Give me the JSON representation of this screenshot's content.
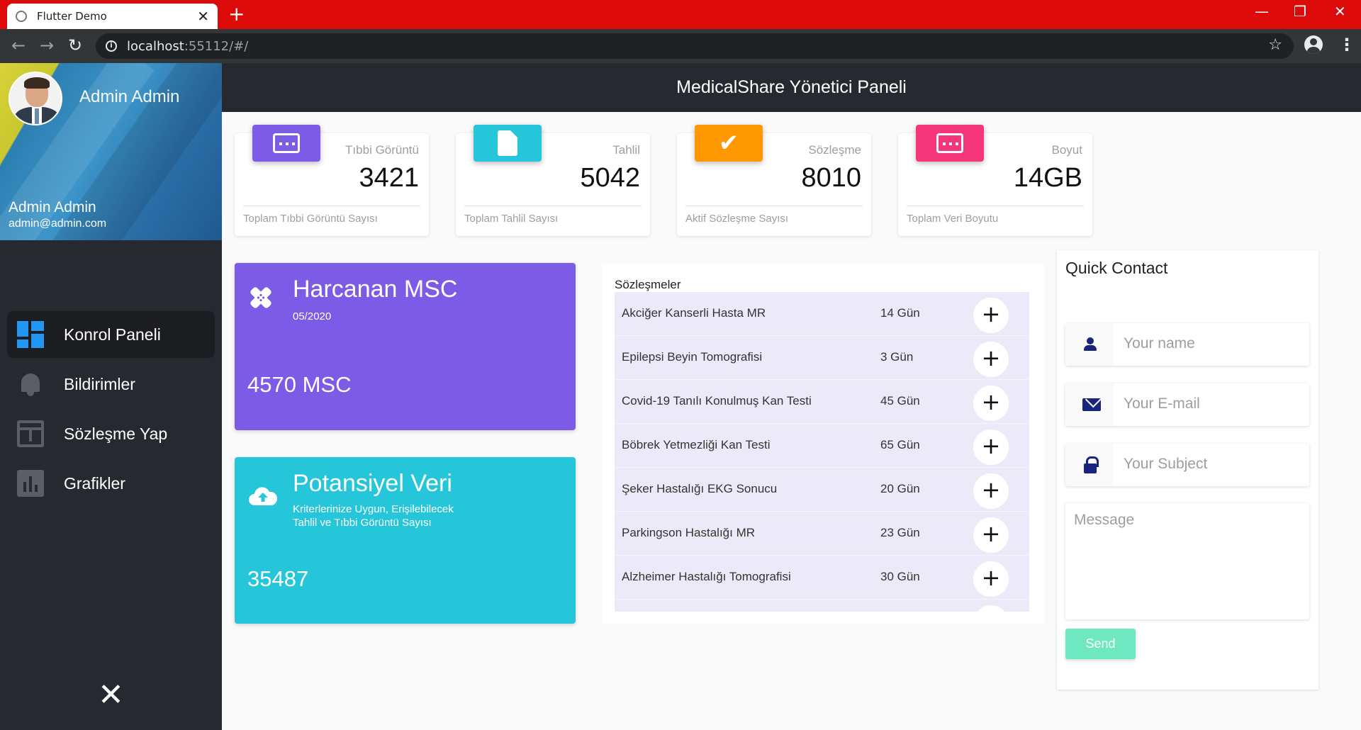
{
  "browser": {
    "tab_title": "Flutter Demo",
    "url_host": "localhost",
    "url_rest": ":55112/#/"
  },
  "sidebar": {
    "header_name": "Admin Admin",
    "user_name": "Admin Admin",
    "user_email": "admin@admin.com",
    "items": [
      {
        "label": "Konrol Paneli",
        "icon": "dashboard-icon",
        "active": true
      },
      {
        "label": "Bildirimler",
        "icon": "bell-icon",
        "active": false
      },
      {
        "label": "Sözleşme Yap",
        "icon": "contract-icon",
        "active": false
      },
      {
        "label": "Grafikler",
        "icon": "bar-chart-icon",
        "active": false
      }
    ]
  },
  "appbar": {
    "title": "MedicalShare Yönetici Paneli"
  },
  "stats": [
    {
      "label": "Tıbbi Görüntü",
      "value": "3421",
      "footer": "Toplam Tıbbi Görüntü Sayısı",
      "color": "#7c5ce6",
      "icon": "web-window-icon"
    },
    {
      "label": "Tahlil",
      "value": "5042",
      "footer": "Toplam Tahlil Sayısı",
      "color": "#26c6da",
      "icon": "document-icon"
    },
    {
      "label": "Sözleşme",
      "value": "8010",
      "footer": "Aktif Sözleşme Sayısı",
      "color": "#ff9800",
      "icon": "check-icon"
    },
    {
      "label": "Boyut",
      "value": "14GB",
      "footer": "Toplam Veri Boyutu",
      "color": "#f5367a",
      "icon": "web-window-icon"
    }
  ],
  "msc_card": {
    "title": "Harcanan MSC",
    "subtitle": "05/2020",
    "value": "4570 MSC",
    "color": "#7c5ce6",
    "icon": "bandage-icon"
  },
  "data_card": {
    "title": "Potansiyel Veri",
    "subtitle_line1": "Kriterlerinize Uygun, Erişilebilecek",
    "subtitle_line2": "Tahlil ve Tıbbi Görüntü Sayısı",
    "value": "35487",
    "color": "#26c6da",
    "icon": "cloud-upload-icon"
  },
  "contracts": {
    "heading": "Sözleşmeler",
    "rows": [
      {
        "name": "Akciğer Kanserli Hasta MR",
        "days": "14 Gün"
      },
      {
        "name": "Epilepsi Beyin Tomografisi",
        "days": "3 Gün"
      },
      {
        "name": "Covid-19 Tanılı Konulmuş Kan Testi",
        "days": "45 Gün"
      },
      {
        "name": "Böbrek Yetmezliği Kan Testi",
        "days": "65 Gün"
      },
      {
        "name": "Şeker Hastalığı EKG Sonucu",
        "days": "20 Gün"
      },
      {
        "name": "Parkingson Hastalığı MR",
        "days": "23 Gün"
      },
      {
        "name": "Alzheimer Hastalığı Tomografisi",
        "days": "30 Gün"
      }
    ],
    "add_symbol": "+"
  },
  "quick_contact": {
    "title": "Quick Contact",
    "name_placeholder": "Your name",
    "email_placeholder": "Your E-mail",
    "subject_placeholder": "Your Subject",
    "message_placeholder": "Message",
    "send_label": "Send"
  }
}
